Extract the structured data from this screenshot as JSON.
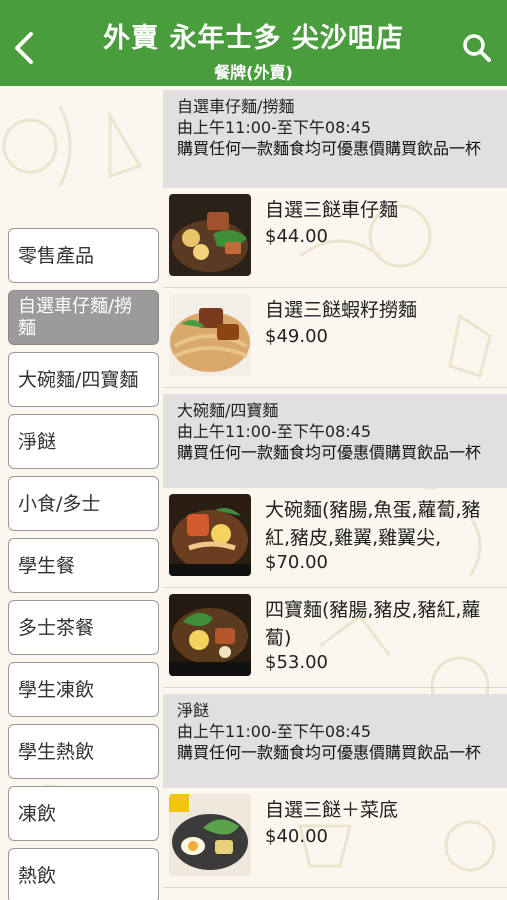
{
  "header": {
    "title": "外賣 永年士多 尖沙咀店",
    "subtitle": "餐牌(外賣)",
    "back_icon": "back-arrow-icon",
    "search_icon": "search-icon",
    "color": "#4a9d3c"
  },
  "sidebar": {
    "items": [
      {
        "label": "零售產品"
      },
      {
        "label": "自選車仔麵/撈麵",
        "active": true
      },
      {
        "label": "大碗麵/四寶麵"
      },
      {
        "label": "淨餸"
      },
      {
        "label": "小食/多士"
      },
      {
        "label": "學生餐"
      },
      {
        "label": "多士茶餐"
      },
      {
        "label": "學生凍飲"
      },
      {
        "label": "學生熱飲"
      },
      {
        "label": "凍飲"
      },
      {
        "label": "熱飲"
      }
    ]
  },
  "sections": [
    {
      "title": "自選車仔麵/撈麵",
      "hours": "由上午11:00-至下午08:45",
      "note": "購買任何一款麵食均可優惠價購買飲品一杯",
      "items": [
        {
          "name": "自選三餸車仔麵",
          "price": "$44.00"
        },
        {
          "name": "自選三餸蝦籽撈麵",
          "price": "$49.00"
        }
      ]
    },
    {
      "title": "大碗麵/四寶麵",
      "hours": "由上午11:00-至下午08:45",
      "note": "購買任何一款麵食均可優惠價購買飲品一杯",
      "items": [
        {
          "name": "大碗麵(豬腸,魚蛋,蘿蔔,豬紅,豬皮,雞翼,雞翼尖,",
          "price": "$70.00"
        },
        {
          "name": "四寶麵(豬腸,豬皮,豬紅,蘿蔔)",
          "price": "$53.00"
        }
      ]
    },
    {
      "title": "淨餸",
      "hours": "由上午11:00-至下午08:45",
      "note": "購買任何一款麵食均可優惠價購買飲品一杯",
      "items": [
        {
          "name": "自選三餸＋菜底",
          "price": "$40.00"
        }
      ]
    }
  ]
}
